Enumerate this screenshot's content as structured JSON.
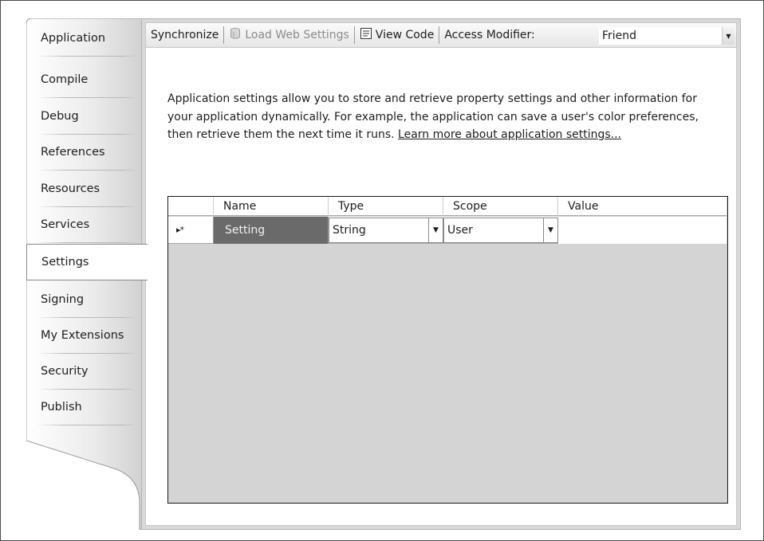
{
  "sidebar": {
    "tabs": [
      {
        "label": "Application"
      },
      {
        "label": "Compile"
      },
      {
        "label": "Debug"
      },
      {
        "label": "References"
      },
      {
        "label": "Resources"
      },
      {
        "label": "Services"
      },
      {
        "label": "Settings",
        "active": true
      },
      {
        "label": "Signing"
      },
      {
        "label": "My Extensions"
      },
      {
        "label": "Security"
      },
      {
        "label": "Publish"
      }
    ]
  },
  "toolbar": {
    "synchronize": "Synchronize",
    "load_web_settings": "Load Web Settings",
    "load_web_settings_icon": "database-icon",
    "view_code": "View Code",
    "view_code_icon": "code-file-icon",
    "access_modifier_label": "Access Modifier:",
    "access_modifier_value": "Friend"
  },
  "description": {
    "text": "Application settings allow you to store and retrieve property settings and other information for your application dynamically. For example, the application can save a user's color preferences, then retrieve them the next time it runs.",
    "link": "Learn more about application settings..."
  },
  "grid": {
    "columns": [
      "Name",
      "Type",
      "Scope",
      "Value"
    ],
    "rows": [
      {
        "indicator": "▸*",
        "name": "Setting",
        "type": "String",
        "scope": "User",
        "value": ""
      }
    ]
  },
  "colors": {
    "panel_bg": "#d8d8d8",
    "selected_cell": "#6a6a6a",
    "grid_empty": "#d4d4d4"
  }
}
